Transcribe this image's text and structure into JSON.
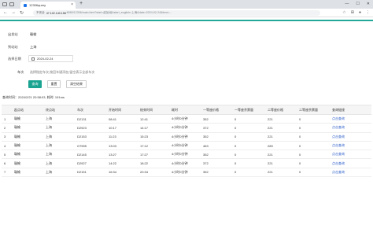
{
  "browser": {
    "tab_title": "12306query",
    "new_tab": "+",
    "window_controls": [
      "—",
      "☐",
      "✕"
    ],
    "url_warning": "不安全",
    "url_host": "47.102.140.158",
    "url_rest": ":8080/12306/main.html?start=起始地&start_english=上海&date=2024-02-24&time=..."
  },
  "form": {
    "start_label": "出发站",
    "start_value": "赣榆",
    "arrive_label": "到站站",
    "arrive_value": "上海",
    "date_label": "选择日期",
    "date_value": "2024-02-24",
    "train_label": "车次",
    "train_placeholder": "选择指定车次,按回车键添加,留空表示全部车次",
    "search_button": "查询",
    "reset_button": "重置",
    "clear_button": "清空结果"
  },
  "query_time": "查询时间：2024/2/21 20:58:03, 耗时: 191ms",
  "table": {
    "headers": [
      "",
      "起点站",
      "终点站",
      "车次",
      "开始时间",
      "结束时间",
      "耗时",
      "一等座价格",
      "一等座余票量",
      "二等座价格",
      "二等座余票量",
      "查询链接"
    ],
    "rows": [
      [
        "1",
        "赣榆",
        "上海",
        "D2131",
        "08:41",
        "12:41",
        "4小时0分钟",
        "352",
        "0",
        "221",
        "0",
        "点击查询"
      ],
      [
        "2",
        "赣榆",
        "上海",
        "D2923",
        "10:17",
        "14:17",
        "4小时0分钟",
        "372",
        "0",
        "221",
        "0",
        "点击查询"
      ],
      [
        "3",
        "赣榆",
        "上海",
        "D2153",
        "11:23",
        "15:23",
        "4小时0分钟",
        "352",
        "0",
        "221",
        "0",
        "点击查询"
      ],
      [
        "4",
        "赣榆",
        "上海",
        "G7595",
        "13:03",
        "17:12",
        "4小时9分钟",
        "463",
        "0",
        "289",
        "0",
        "点击查询"
      ],
      [
        "5",
        "赣榆",
        "上海",
        "D2145",
        "13:27",
        "17:27",
        "4小时0分钟",
        "352",
        "0",
        "221",
        "0",
        "点击查询"
      ],
      [
        "6",
        "赣榆",
        "上海",
        "D2927",
        "14:22",
        "18:22",
        "4小时0分钟",
        "372",
        "0",
        "221",
        "0",
        "点击查询"
      ],
      [
        "7",
        "赣榆",
        "上海",
        "D2151",
        "16:34",
        "20:34",
        "4小时0分钟",
        "352",
        "0",
        "221",
        "0",
        "点击查询"
      ]
    ]
  }
}
